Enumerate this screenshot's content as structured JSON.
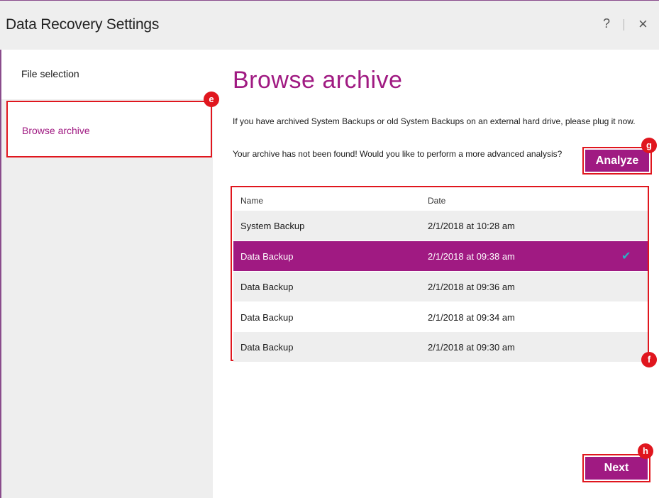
{
  "window": {
    "title": "Data Recovery Settings",
    "help_label": "?",
    "close_label": "×"
  },
  "sidebar": {
    "items": [
      {
        "label": "File selection",
        "active": false
      },
      {
        "label": "Browse archive",
        "active": true
      }
    ]
  },
  "callouts": {
    "e": "e",
    "f": "f",
    "g": "g",
    "h": "h"
  },
  "main": {
    "title": "Browse archive",
    "info_text": "If you have archived System Backups or old System Backups on an external hard drive, please plug it now.",
    "warning_text": "Your archive has not been found! Would you like to perform a more advanced analysis?",
    "analyze_label": "Analyze",
    "next_label": "Next"
  },
  "table": {
    "headers": [
      "Name",
      "Date"
    ],
    "rows": [
      {
        "name": "System Backup",
        "date": "2/1/2018 at 10:28 am",
        "selected": false
      },
      {
        "name": "Data Backup",
        "date": "2/1/2018 at 09:38 am",
        "selected": true,
        "check": "✔"
      },
      {
        "name": "Data Backup",
        "date": "2/1/2018 at 09:36 am",
        "selected": false
      },
      {
        "name": "Data Backup",
        "date": "2/1/2018 at 09:34 am",
        "selected": false
      },
      {
        "name": "Data Backup",
        "date": "2/1/2018 at 09:30 am",
        "selected": false
      }
    ]
  },
  "colors": {
    "accent": "#a01a82",
    "highlight_red": "#e0161e",
    "check": "#2ab0c4",
    "sidebar_bg": "#eeeeee"
  }
}
